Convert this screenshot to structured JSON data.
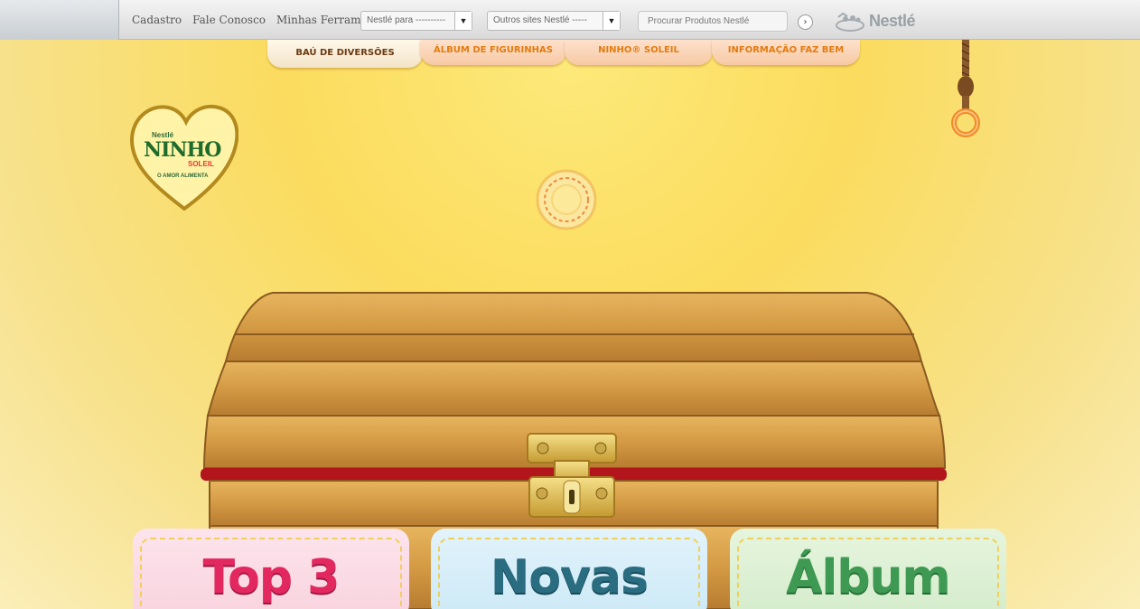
{
  "topbar": {
    "links": [
      "Cadastro",
      "Fale Conosco",
      "Minhas Ferramentas"
    ],
    "select1": "Nestlé para ----------",
    "select2": "Outros sites Nestlé -----",
    "search_placeholder": "Procurar Produtos Nestlé",
    "brand": "Nestlé"
  },
  "tabs": [
    {
      "label": "BAÚ DE DIVERSÕES",
      "active": true
    },
    {
      "label": "ÁLBUM DE FIGURINHAS",
      "active": false
    },
    {
      "label": "NINHO® SOLEIL",
      "active": false
    },
    {
      "label": "INFORMAÇÃO FAZ BEM",
      "active": false
    }
  ],
  "logo": {
    "brand": "Nestlé",
    "name": "NINHO",
    "sub": "SOLEIL",
    "tagline": "O AMOR ALIMENTA"
  },
  "cards": [
    {
      "label": "Top 3",
      "color": "#e2285f"
    },
    {
      "label": "Novas",
      "color": "#2a6c80"
    },
    {
      "label": "Álbum",
      "color": "#3e9a52"
    }
  ]
}
